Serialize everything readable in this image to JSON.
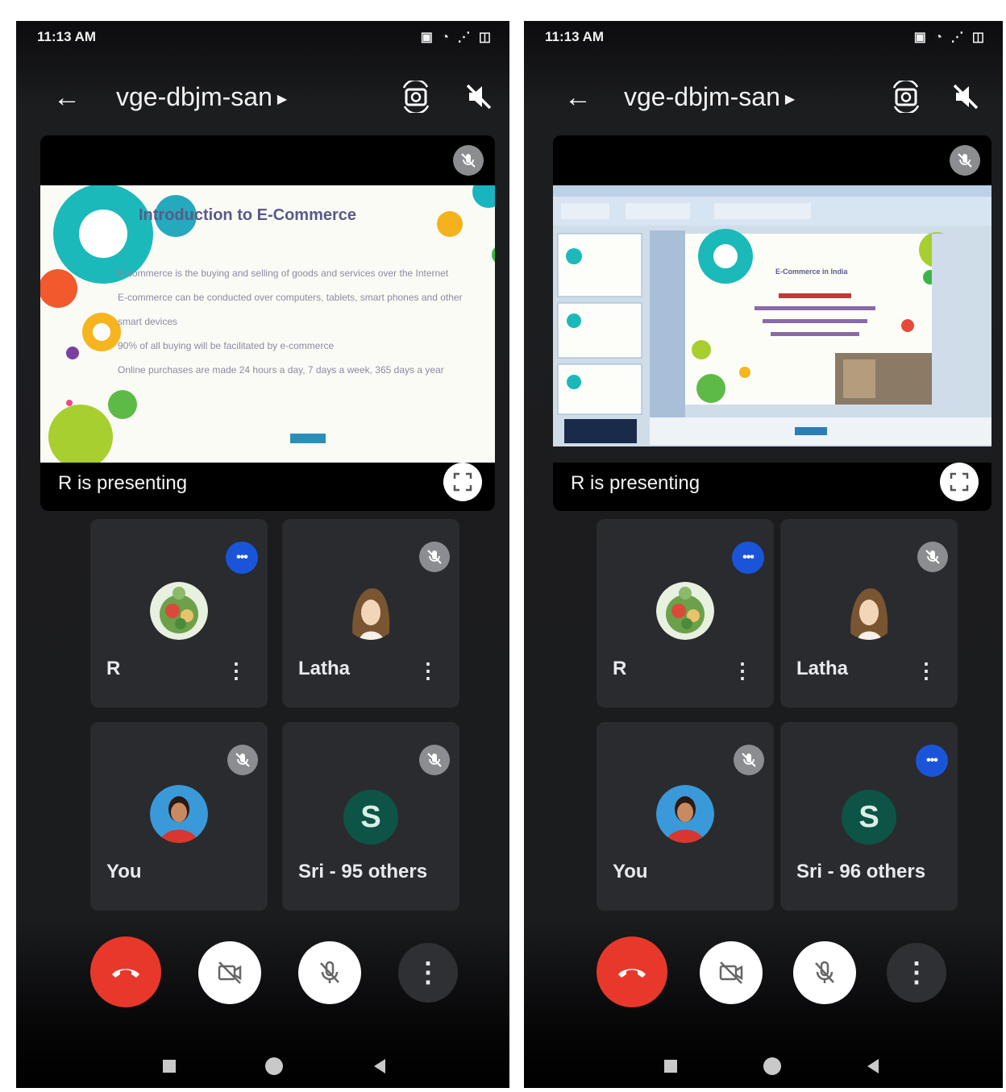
{
  "screens": [
    {
      "status_time": "11:13 AM",
      "status_icons": "▣ ◔ ⋰ ◫",
      "meeting_code": "vge-dbjm-san",
      "presenting_label": "R is presenting",
      "slide_title": "Introduction to E-Commerce",
      "slide_lines": [
        "E-commerce is the buying and selling of goods and services over the Internet",
        "E-commerce can be conducted over computers, tablets, smart phones and other smart devices",
        "90% of all buying will be facilitated by e-commerce",
        "Online purchases are made 24 hours a day, 7 days a week, 365 days a year"
      ],
      "participants": [
        {
          "name": "R",
          "speaking": true
        },
        {
          "name": "Latha",
          "speaking": false
        },
        {
          "name": "You",
          "speaking": false
        },
        {
          "name": "Sri - 95 others",
          "initial": "S",
          "speaking": false
        }
      ]
    },
    {
      "status_time": "11:13 AM",
      "status_icons": "▣ ◔ ⋰ ◫",
      "meeting_code": "vge-dbjm-san",
      "presenting_label": "R is presenting",
      "slide_title": "E-Commerce in India",
      "slide_lines": [],
      "participants": [
        {
          "name": "R",
          "speaking": true
        },
        {
          "name": "Latha",
          "speaking": false
        },
        {
          "name": "You",
          "speaking": false
        },
        {
          "name": "Sri - 96 others",
          "initial": "S",
          "speaking": true
        }
      ]
    }
  ],
  "icons": {
    "back": "arrow-left-icon",
    "switch_camera": "switch-camera-icon",
    "speaker_off": "speaker-off-icon",
    "mic_off": "mic-off-icon",
    "fullscreen": "fullscreen-icon",
    "end_call": "end-call-icon",
    "camera_off": "camera-off-icon",
    "more": "more-vert-icon"
  },
  "colors": {
    "end_call": "#e8382b",
    "speaking_badge": "#1a55d9",
    "letter_avatar": "#0d5447",
    "tile_bg": "#2a2b2e"
  }
}
